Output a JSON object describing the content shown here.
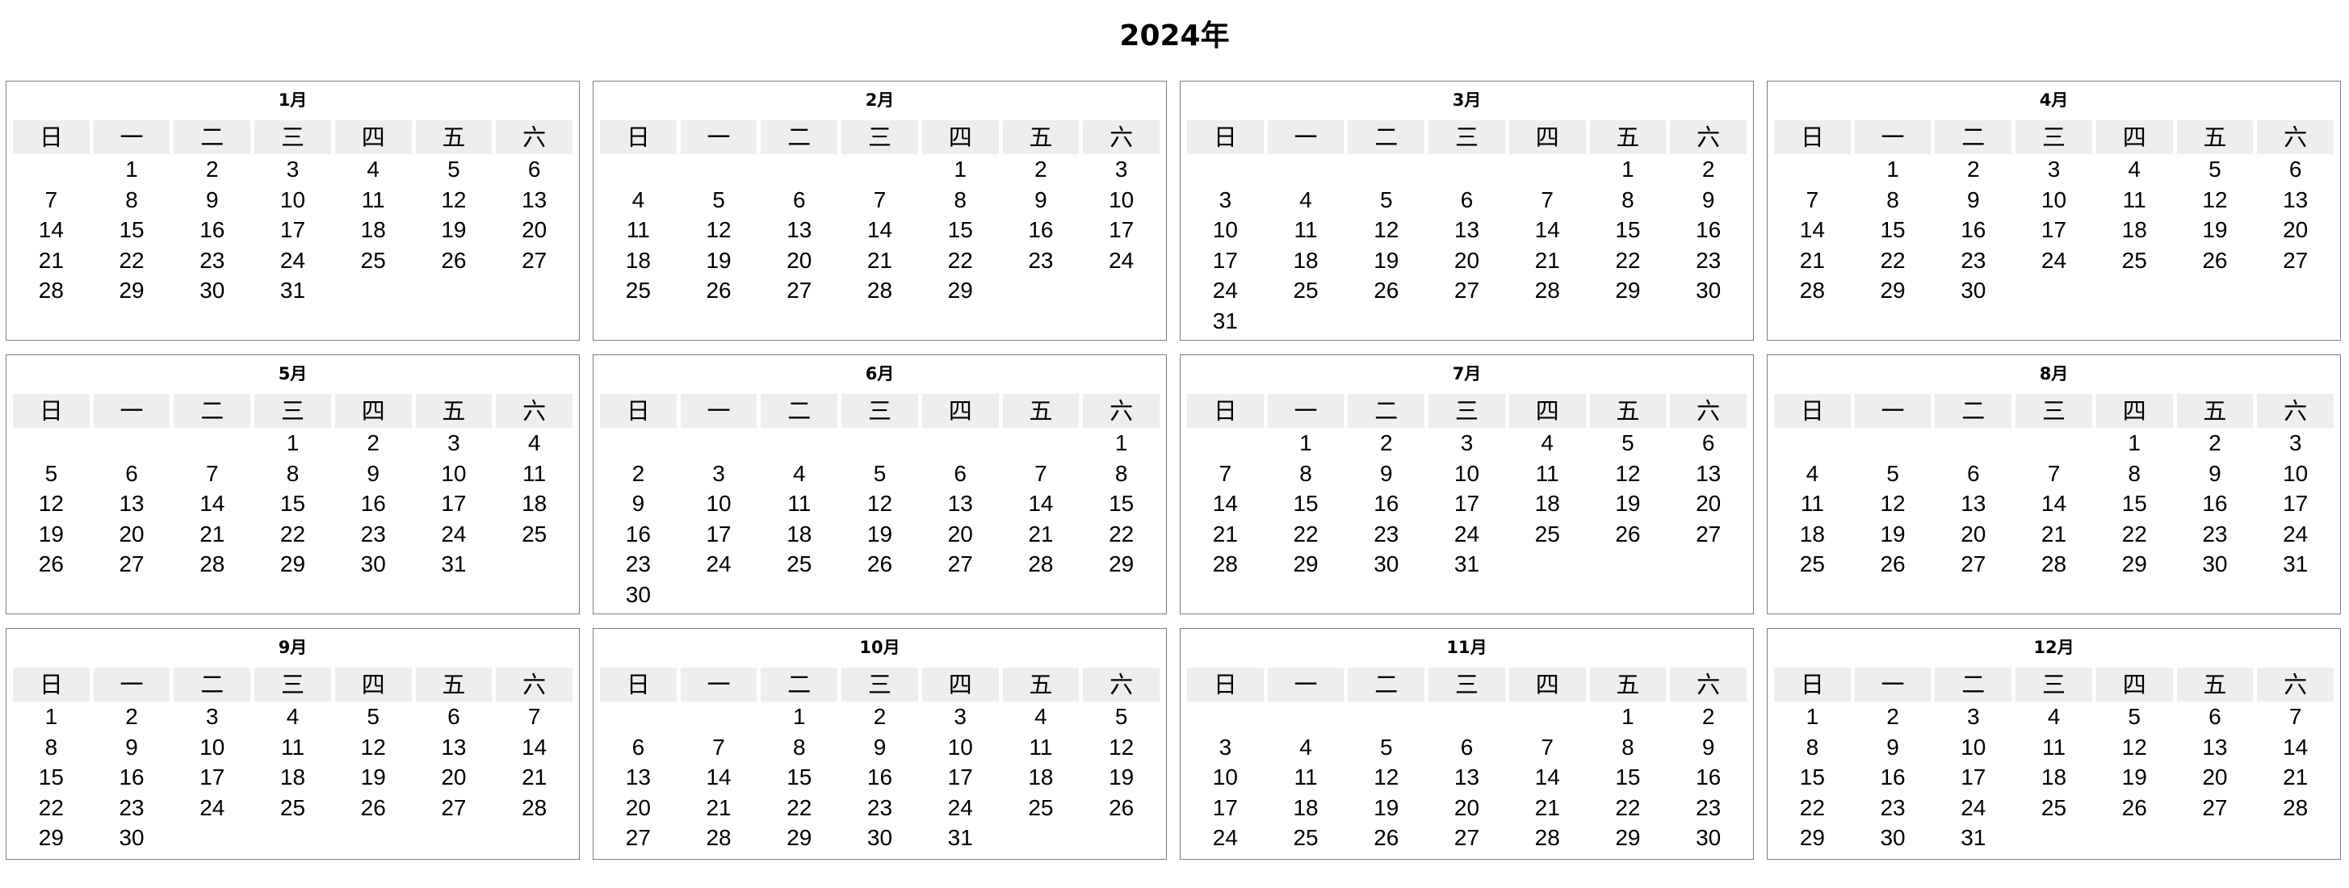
{
  "title": "2024年",
  "weekdays": [
    "日",
    "一",
    "二",
    "三",
    "四",
    "五",
    "六"
  ],
  "months": [
    {
      "label": "1月",
      "first_weekday": 1,
      "days": 31
    },
    {
      "label": "2月",
      "first_weekday": 4,
      "days": 29
    },
    {
      "label": "3月",
      "first_weekday": 5,
      "days": 31
    },
    {
      "label": "4月",
      "first_weekday": 1,
      "days": 30
    },
    {
      "label": "5月",
      "first_weekday": 3,
      "days": 31
    },
    {
      "label": "6月",
      "first_weekday": 6,
      "days": 30
    },
    {
      "label": "7月",
      "first_weekday": 1,
      "days": 31
    },
    {
      "label": "8月",
      "first_weekday": 4,
      "days": 31
    },
    {
      "label": "9月",
      "first_weekday": 0,
      "days": 30
    },
    {
      "label": "10月",
      "first_weekday": 2,
      "days": 31
    },
    {
      "label": "11月",
      "first_weekday": 5,
      "days": 30
    },
    {
      "label": "12月",
      "first_weekday": 0,
      "days": 31
    }
  ]
}
